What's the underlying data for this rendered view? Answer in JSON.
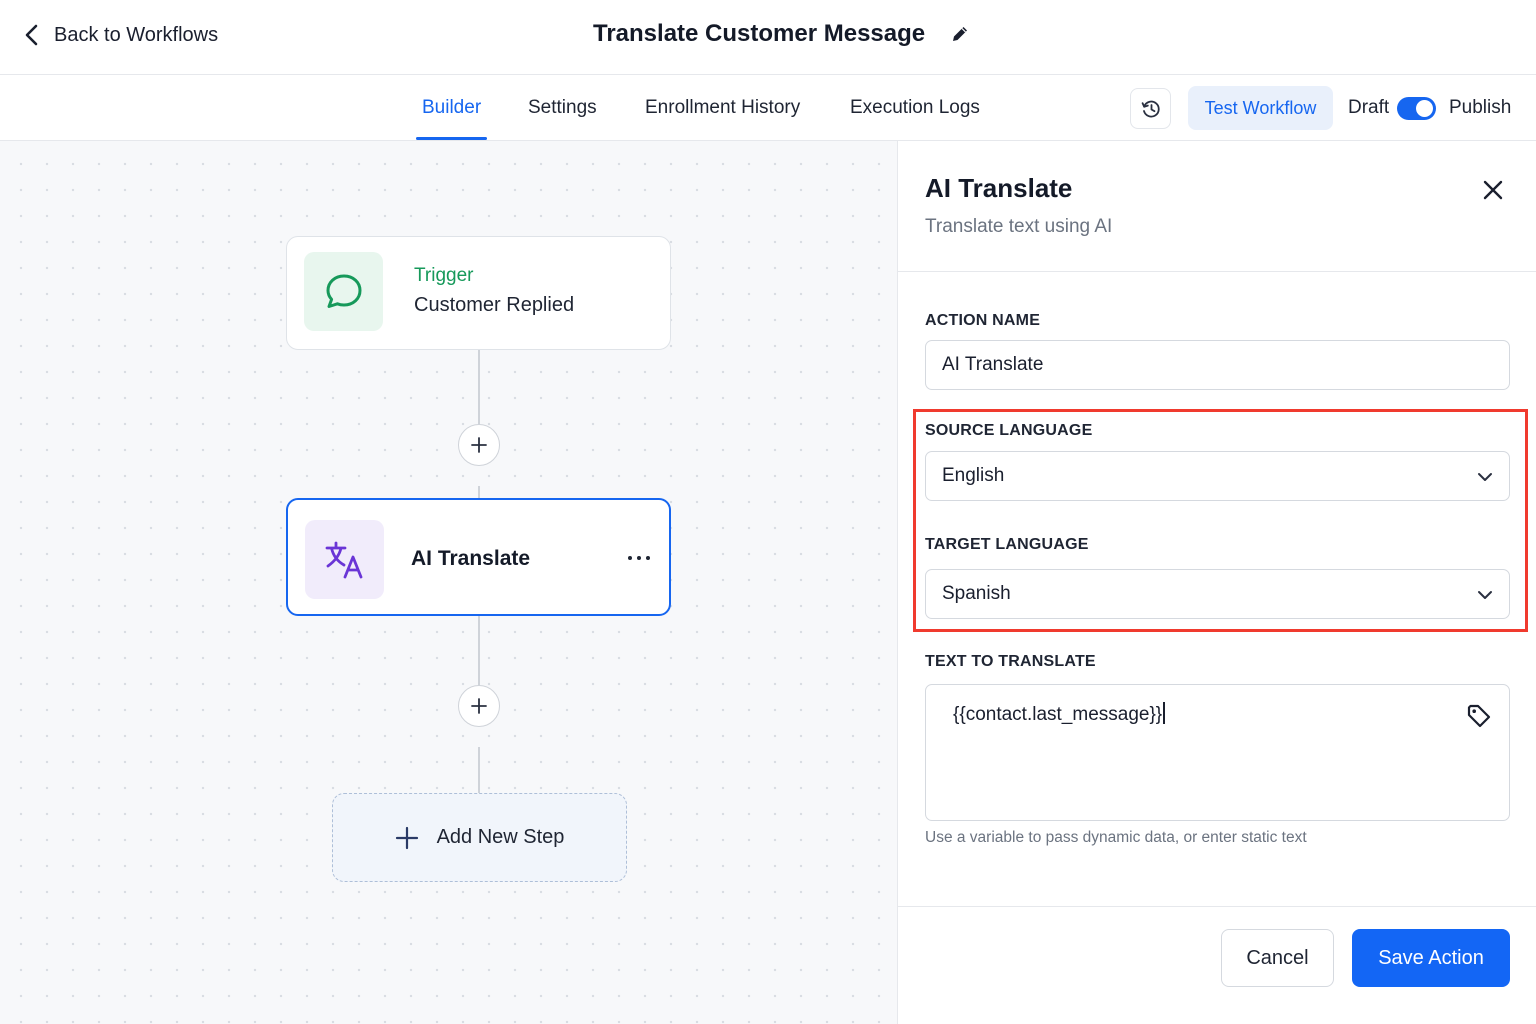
{
  "header": {
    "back_label": "Back to Workflows",
    "title": "Translate Customer Message"
  },
  "tabs": [
    {
      "label": "Builder",
      "active": true
    },
    {
      "label": "Settings",
      "active": false
    },
    {
      "label": "Enrollment History",
      "active": false
    },
    {
      "label": "Execution Logs",
      "active": false
    }
  ],
  "toolbar": {
    "test_label": "Test Workflow",
    "draft_label": "Draft",
    "publish_label": "Publish",
    "publish_toggle_on": true
  },
  "canvas": {
    "trigger": {
      "kicker": "Trigger",
      "name": "Customer Replied",
      "icon": "chat-bubble-icon"
    },
    "action": {
      "name": "AI Translate",
      "icon": "translate-icon"
    },
    "add_step_label": "Add New Step"
  },
  "panel": {
    "title": "AI Translate",
    "subtitle": "Translate text using AI",
    "action_name": {
      "label": "ACTION NAME",
      "value": "AI Translate"
    },
    "source_language": {
      "label": "SOURCE LANGUAGE",
      "value": "English"
    },
    "target_language": {
      "label": "TARGET LANGUAGE",
      "value": "Spanish"
    },
    "text_to_translate": {
      "label": "TEXT TO TRANSLATE",
      "value": "{{contact.last_message}}"
    },
    "hint": "Use a variable to pass dynamic data, or enter static text",
    "cancel_label": "Cancel",
    "save_label": "Save Action"
  },
  "colors": {
    "accent": "#1666f0",
    "trigger_green": "#16995a",
    "highlight_red": "#f03a2e",
    "translate_purple": "#6a35d6"
  }
}
